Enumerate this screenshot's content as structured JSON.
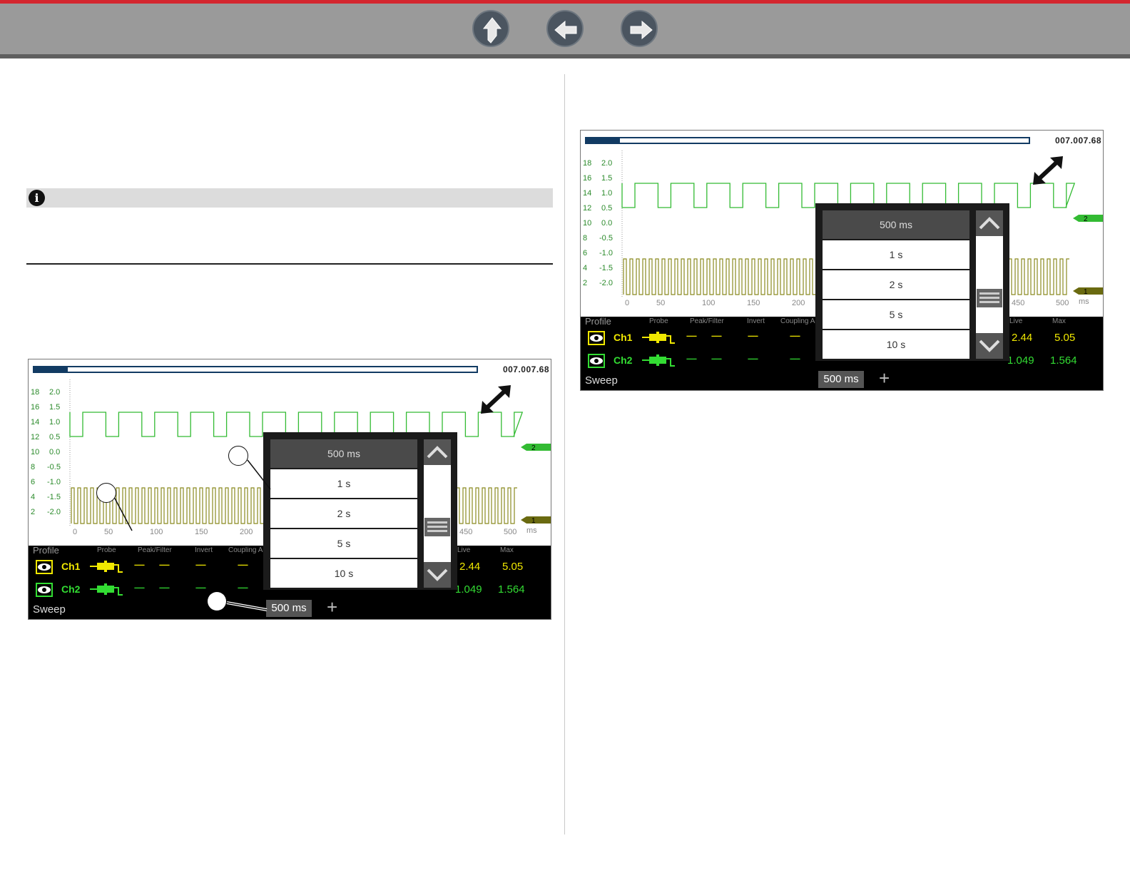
{
  "nav": {
    "home_icon": "home-arrow-icon",
    "back_icon": "arrow-left-icon",
    "forward_icon": "arrow-right-icon"
  },
  "note": {
    "icon": "info-icon",
    "icon_glyph": "i"
  },
  "scope": {
    "version": "007.007.68",
    "progress": 0.075,
    "y_left": [
      "18",
      "16",
      "14",
      "12",
      "10",
      "8",
      "6",
      "4",
      "2"
    ],
    "y_right": [
      "2.0",
      "1.5",
      "1.0",
      "0.5",
      "0.0",
      "-0.5",
      "-1.0",
      "-1.5",
      "-2.0"
    ],
    "x_ticks_left": [
      "0",
      "50",
      "100",
      "150",
      "200"
    ],
    "x_ticks_right": [
      "450",
      "500"
    ],
    "x_unit": "ms",
    "markers": {
      "ch2": "2",
      "ch1": "1"
    },
    "header": {
      "profile": "Profile",
      "probe": "Probe",
      "peak": "Peak/Filter",
      "invert": "Invert",
      "coupling": "Coupling AC",
      "live": "Live",
      "max": "Max"
    },
    "channels": [
      {
        "label": "Ch1",
        "dashes": "------",
        "live": "2.44",
        "max": "5.05",
        "color": "#f0e800"
      },
      {
        "label": "Ch2",
        "dashes": "------",
        "live": "1.049",
        "max": "1.564",
        "color": "#33dd33"
      }
    ],
    "sweep_label": "Sweep",
    "sweep_value": "500 ms",
    "plus": "+",
    "dropdown": {
      "selected": "500 ms",
      "options": [
        "1 s",
        "2 s",
        "5 s",
        "10 s"
      ]
    }
  }
}
